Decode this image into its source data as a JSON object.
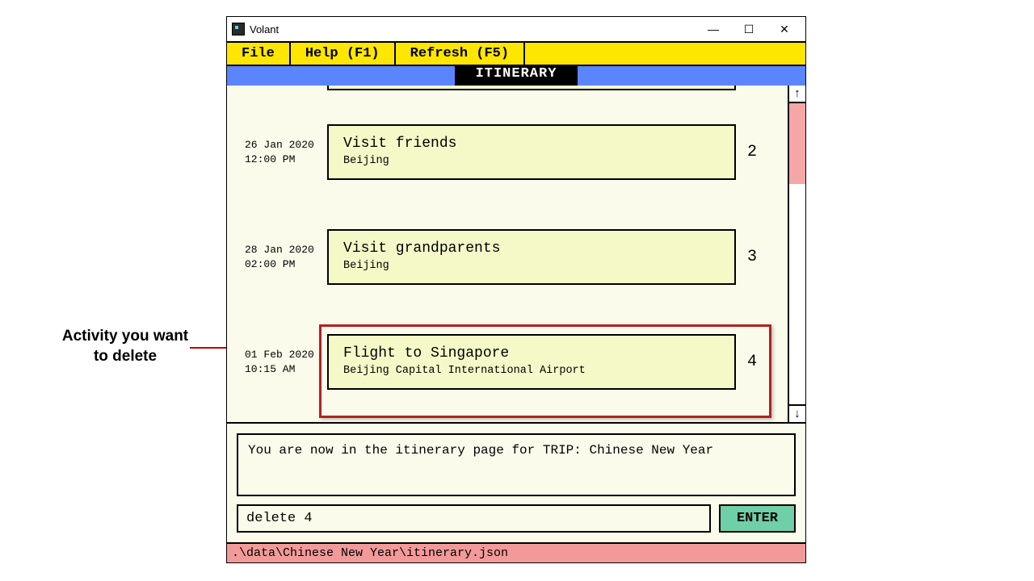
{
  "annotation": {
    "line1": "Activity you want",
    "line2": "to delete"
  },
  "window": {
    "title": "Volant"
  },
  "menu": {
    "file": "File",
    "help": "Help (F1)",
    "refresh": "Refresh (F5)"
  },
  "header": {
    "tab": "ITINERARY"
  },
  "entries": [
    {
      "date": "26 Jan 2020",
      "time": "12:00 PM",
      "title": "Visit friends",
      "location": "Beijing",
      "index": "2"
    },
    {
      "date": "28 Jan 2020",
      "time": "02:00 PM",
      "title": "Visit grandparents",
      "location": "Beijing",
      "index": "3"
    },
    {
      "date": "01 Feb 2020",
      "time": "10:15 AM",
      "title": "Flight to Singapore",
      "location": "Beijing Capital International Airport",
      "index": "4"
    }
  ],
  "status": {
    "text": "You are now in the itinerary page for TRIP: Chinese New Year"
  },
  "command": {
    "value": "delete 4",
    "enter": "ENTER"
  },
  "path": {
    "text": ".\\data\\Chinese New Year\\itinerary.json"
  },
  "scroll": {
    "up": "↑",
    "down": "↓"
  }
}
